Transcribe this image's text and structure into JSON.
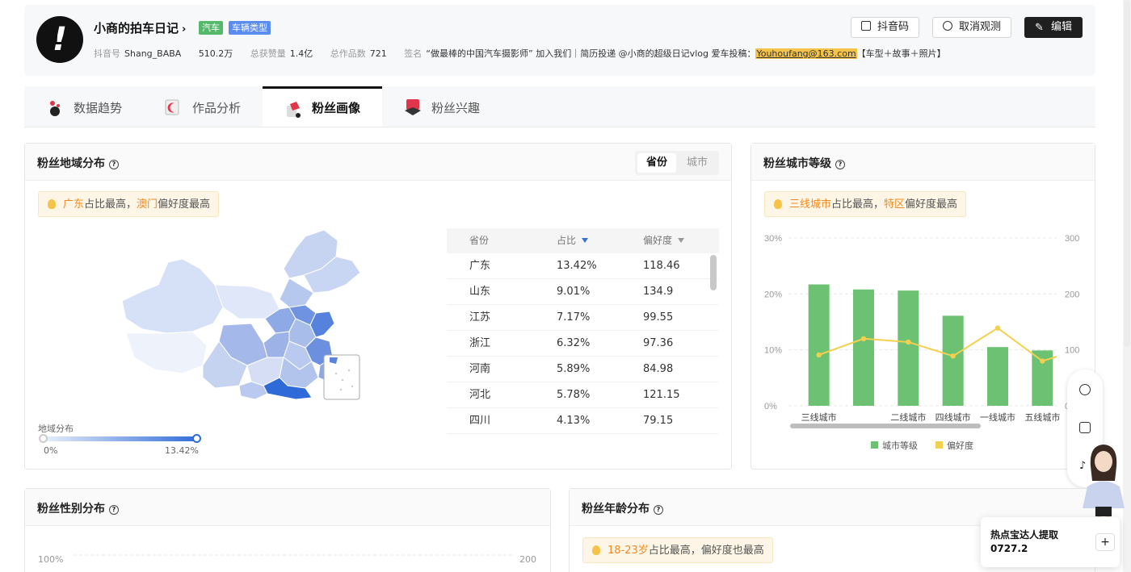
{
  "profile": {
    "name": "小商的拍车日记",
    "chevron": "›",
    "tags": [
      "汽车",
      "车辆类型"
    ],
    "douyin_id_label": "抖音号",
    "douyin_id": "Shang_BABA",
    "followers": "510.2万",
    "likes_label": "总获赞量",
    "likes": "1.4亿",
    "works_label": "总作品数",
    "works": "721",
    "sign_label": "签名",
    "sign_text": "“做最棒的中国汽车摄影师” 加入我们｜简历投递 @小商的超级日记vlog 爱车投稿：",
    "email": "Youhoufang@163.com",
    "sign_tail": "【车型＋故事＋照片】",
    "buttons": {
      "qr": "抖音码",
      "unwatch": "取消观测",
      "edit": "编辑"
    }
  },
  "tabs": [
    {
      "label": "数据趋势",
      "active": false,
      "icon": "trend-icon"
    },
    {
      "label": "作品分析",
      "active": false,
      "icon": "works-icon"
    },
    {
      "label": "粉丝画像",
      "active": true,
      "icon": "fan-portrait-icon"
    },
    {
      "label": "粉丝兴趣",
      "active": false,
      "icon": "fan-interest-icon"
    }
  ],
  "region": {
    "title": "粉丝地域分布",
    "seg": [
      "省份",
      "城市"
    ],
    "tip": {
      "a": "广东",
      "b": "占比最高，",
      "c": "澳门",
      "d": "偏好度最高"
    },
    "table": {
      "headers": [
        "省份",
        "占比",
        "偏好度"
      ],
      "rows": [
        [
          "广东",
          "13.42%",
          "118.46"
        ],
        [
          "山东",
          "9.01%",
          "134.9"
        ],
        [
          "江苏",
          "7.17%",
          "99.55"
        ],
        [
          "浙江",
          "6.32%",
          "97.36"
        ],
        [
          "河南",
          "5.89%",
          "84.98"
        ],
        [
          "河北",
          "5.78%",
          "121.15"
        ],
        [
          "四川",
          "4.13%",
          "79.15"
        ]
      ]
    },
    "legend_title": "地域分布",
    "legend_min": "0%",
    "legend_max": "13.42%"
  },
  "city_level": {
    "title": "粉丝城市等级",
    "tip": {
      "a": "三线城市",
      "b": "占比最高，",
      "c": "特区",
      "d": "偏好度最高"
    },
    "y_left": [
      "30%",
      "20%",
      "10%",
      "0%"
    ],
    "y_right": [
      "300",
      "200",
      "100",
      "0"
    ],
    "legend": [
      "城市等级",
      "偏好度"
    ]
  },
  "chart_data": {
    "type": "bar",
    "categories": [
      "三线城市",
      "",
      "二线城市",
      "四线城市",
      "一线城市",
      "五线城市"
    ],
    "series": [
      {
        "name": "城市等级",
        "type": "bar",
        "axis": "left",
        "values": [
          21.7,
          20.8,
          20.6,
          16.1,
          10.5,
          9.9
        ]
      },
      {
        "name": "偏好度",
        "type": "line",
        "axis": "right",
        "values": [
          91,
          120,
          114,
          89,
          139,
          80
        ]
      }
    ],
    "ylim": [
      0,
      30
    ],
    "ylim_right": [
      0,
      300
    ],
    "colors": {
      "bar": "#6cc272",
      "line": "#f4d04f"
    }
  },
  "gender": {
    "title": "粉丝性别分布",
    "y_left_top": "100%",
    "y_right_top": "200"
  },
  "age": {
    "title": "粉丝年龄分布",
    "tip": {
      "a": "18-23岁",
      "b": "占比最高，偏好度也最高"
    }
  },
  "hot": {
    "line1": "热点宝达人提取",
    "line2": "0727.2",
    "plus": "+"
  },
  "colors": {
    "accent": "#2f6bd8",
    "orange": "#f08a24",
    "bar_green": "#6cc272",
    "line_yellow": "#f4d04f"
  }
}
